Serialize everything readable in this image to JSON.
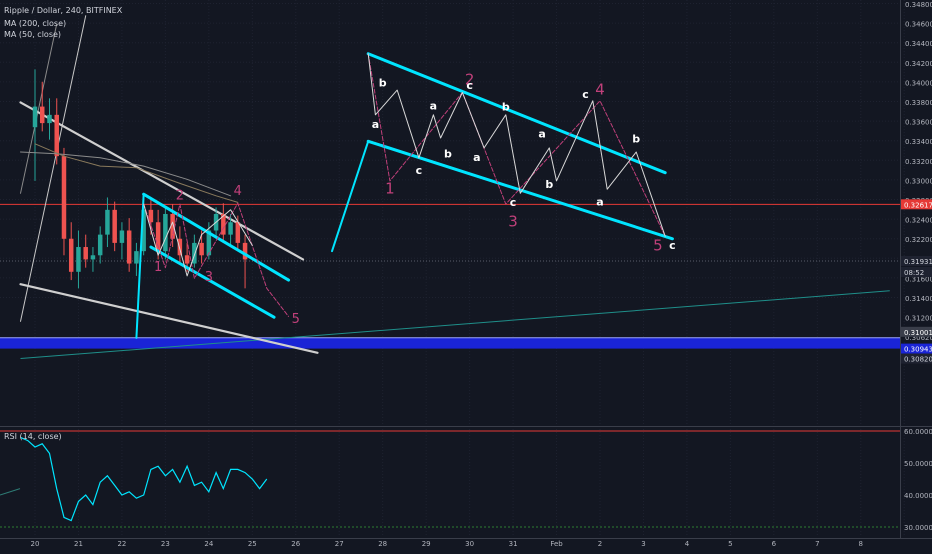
{
  "header": {
    "symbol_line": "Ripple / Dollar, 240, BITFINEX",
    "ma200_label": "MA (200, close)",
    "ma50_label": "MA (50, close)",
    "rsi_label": "RSI (14, close)"
  },
  "colors": {
    "background": "#131722",
    "up_candle": "#26a69a",
    "down_candle": "#ef5350",
    "wedge_lines": "#ffffff",
    "channel": "#00e5ff",
    "wave_primary": "#c0407a",
    "wave_subwave": "#ffffff",
    "red_level": "#e53935",
    "blue_zone": "#1a24d6",
    "rsi_line": "#00e5ff"
  },
  "chart_data": [
    {
      "type": "candlestick",
      "title": "Ripple / Dollar, 240, BITFINEX",
      "y_axis_side": "right",
      "y_tick_labels": [
        "0.34800",
        "0.34600",
        "0.34400",
        "0.34200",
        "0.34000",
        "0.33800",
        "0.33600",
        "0.33400",
        "0.33200",
        "0.33000",
        "0.32800",
        "0.32400",
        "0.32200",
        "0.32000",
        "0.31600",
        "0.31400",
        "0.31200",
        "0.30620",
        "0.30640"
      ],
      "x_tick_labels": [
        "20",
        "21",
        "22",
        "23",
        "24",
        "25",
        "26",
        "27",
        "28",
        "29",
        "30",
        "31",
        "Feb",
        "2",
        "3",
        "4",
        "5",
        "6",
        "7",
        "8"
      ],
      "price_labels": {
        "red_level": "0.32617",
        "current_price": "0.31931",
        "countdown": "08:52",
        "zone_top": "0.31001",
        "zone_mid": "0.30943",
        "zone_bottom": "0.30820"
      },
      "candles": [
        {
          "x": "Jan 20 00:00",
          "o": 0.3355,
          "h": 0.3425,
          "l": 0.329,
          "c": 0.338
        },
        {
          "x": "Jan 20 04:00",
          "o": 0.338,
          "h": 0.341,
          "l": 0.335,
          "c": 0.336
        },
        {
          "x": "Jan 20 08:00",
          "o": 0.336,
          "h": 0.339,
          "l": 0.334,
          "c": 0.337
        },
        {
          "x": "Jan 20 12:00",
          "o": 0.337,
          "h": 0.339,
          "l": 0.331,
          "c": 0.332
        },
        {
          "x": "Jan 20 16:00",
          "o": 0.332,
          "h": 0.333,
          "l": 0.32,
          "c": 0.322
        },
        {
          "x": "Jan 20 20:00",
          "o": 0.322,
          "h": 0.324,
          "l": 0.317,
          "c": 0.318
        },
        {
          "x": "Jan 21 00:00",
          "o": 0.318,
          "h": 0.323,
          "l": 0.316,
          "c": 0.321
        },
        {
          "x": "Jan 21 04:00",
          "o": 0.321,
          "h": 0.3225,
          "l": 0.3185,
          "c": 0.3195
        },
        {
          "x": "Jan 21 08:00",
          "o": 0.3195,
          "h": 0.321,
          "l": 0.318,
          "c": 0.32
        },
        {
          "x": "Jan 21 12:00",
          "o": 0.32,
          "h": 0.3235,
          "l": 0.319,
          "c": 0.3225
        },
        {
          "x": "Jan 21 16:00",
          "o": 0.3225,
          "h": 0.327,
          "l": 0.321,
          "c": 0.3255
        },
        {
          "x": "Jan 21 20:00",
          "o": 0.3255,
          "h": 0.3265,
          "l": 0.3205,
          "c": 0.3215
        },
        {
          "x": "Jan 22 00:00",
          "o": 0.3215,
          "h": 0.324,
          "l": 0.3195,
          "c": 0.323
        },
        {
          "x": "Jan 22 04:00",
          "o": 0.323,
          "h": 0.3245,
          "l": 0.318,
          "c": 0.319
        },
        {
          "x": "Jan 22 08:00",
          "o": 0.319,
          "h": 0.3215,
          "l": 0.3175,
          "c": 0.3205
        },
        {
          "x": "Jan 22 12:00",
          "o": 0.3205,
          "h": 0.3265,
          "l": 0.32,
          "c": 0.3255
        },
        {
          "x": "Jan 22 16:00",
          "o": 0.3255,
          "h": 0.327,
          "l": 0.3225,
          "c": 0.324
        },
        {
          "x": "Jan 22 20:00",
          "o": 0.324,
          "h": 0.3255,
          "l": 0.3195,
          "c": 0.3205
        },
        {
          "x": "Jan 23 00:00",
          "o": 0.3205,
          "h": 0.326,
          "l": 0.3195,
          "c": 0.325
        },
        {
          "x": "Jan 23 04:00",
          "o": 0.325,
          "h": 0.3262,
          "l": 0.321,
          "c": 0.322
        },
        {
          "x": "Jan 23 08:00",
          "o": 0.322,
          "h": 0.3235,
          "l": 0.319,
          "c": 0.32
        },
        {
          "x": "Jan 23 12:00",
          "o": 0.32,
          "h": 0.3215,
          "l": 0.318,
          "c": 0.319
        },
        {
          "x": "Jan 23 16:00",
          "o": 0.319,
          "h": 0.3225,
          "l": 0.3185,
          "c": 0.3215
        },
        {
          "x": "Jan 23 20:00",
          "o": 0.3215,
          "h": 0.323,
          "l": 0.319,
          "c": 0.32
        },
        {
          "x": "Jan 24 00:00",
          "o": 0.32,
          "h": 0.324,
          "l": 0.3195,
          "c": 0.323
        },
        {
          "x": "Jan 24 04:00",
          "o": 0.323,
          "h": 0.3258,
          "l": 0.322,
          "c": 0.325
        },
        {
          "x": "Jan 24 08:00",
          "o": 0.325,
          "h": 0.3263,
          "l": 0.3215,
          "c": 0.3225
        },
        {
          "x": "Jan 24 12:00",
          "o": 0.3225,
          "h": 0.325,
          "l": 0.321,
          "c": 0.324
        },
        {
          "x": "Jan 24 16:00",
          "o": 0.324,
          "h": 0.3248,
          "l": 0.3205,
          "c": 0.3215
        },
        {
          "x": "Jan 24 20:00",
          "o": 0.3215,
          "h": 0.3225,
          "l": 0.316,
          "c": 0.3195
        }
      ],
      "series": [
        {
          "name": "MA (200, close)",
          "color": "#8c8c8c",
          "x": [
            "Jan 19 16:00",
            "Jan 20 12:00",
            "Jan 21 12:00",
            "Jan 22 12:00",
            "Jan 23 12:00",
            "Jan 24 12:00"
          ],
          "y": [
            0.3325,
            0.3323,
            0.3318,
            0.3308,
            0.3292,
            0.3272
          ]
        },
        {
          "name": "MA (50, close)",
          "color": "#8a7a5c",
          "x": [
            "Jan 20 00:00",
            "Jan 20 16:00",
            "Jan 21 12:00",
            "Jan 22 08:00",
            "Jan 23 08:00",
            "Jan 24 04:00",
            "Jan 24 16:00"
          ],
          "y": [
            0.3335,
            0.332,
            0.3308,
            0.3306,
            0.3287,
            0.3272,
            0.3264
          ]
        }
      ],
      "annotations": {
        "wedge_upper": [
          [
            "Jan 19 16:00",
            0.3385
          ],
          [
            "Jan 26 04:00",
            0.3195
          ]
        ],
        "wedge_lower": [
          [
            "Jan 19 16:00",
            0.3165
          ],
          [
            "Jan 26 12:00",
            0.3082
          ]
        ],
        "fan_line_1": [
          [
            "Jan 19 16:00",
            0.312
          ],
          [
            "Jan 21 04:00",
            0.349
          ]
        ],
        "fan_line_2": [
          [
            "Jan 19 16:00",
            0.3275
          ],
          [
            "Jan 20 12:00",
            0.348
          ]
        ],
        "small_channel_upper": [
          [
            "Jan 22 12:00",
            0.3274
          ],
          [
            "Jan 25 20:00",
            0.317
          ]
        ],
        "small_channel_lower": [
          [
            "Jan 22 16:00",
            0.321
          ],
          [
            "Jan 25 12:00",
            0.3125
          ]
        ],
        "small_channel_start": [
          [
            "Jan 22 08:00",
            0.31
          ],
          [
            "Jan 22 12:00",
            0.3274
          ]
        ],
        "big_channel_upper": [
          [
            "Jan 27 16:00",
            0.3444
          ],
          [
            "Feb 3 12:00",
            0.33
          ]
        ],
        "big_channel_lower": [
          [
            "Jan 27 16:00",
            0.3338
          ],
          [
            "Feb 3 16:00",
            0.322
          ]
        ],
        "big_channel_start": [
          [
            "Jan 26 20:00",
            0.3205
          ],
          [
            "Jan 27 16:00",
            0.3338
          ]
        ],
        "red_level_price": 0.32617,
        "blue_zone": [
          0.30943,
          0.31001
        ],
        "trendline_teal": [
          [
            "Jan 19 16:00",
            0.3075
          ],
          [
            "Feb 8 16:00",
            0.3157
          ]
        ],
        "wave_small_pink": [
          [
            "Jan 22 12:00",
            0.3262
          ],
          [
            "Jan 23 00:00",
            0.3185
          ],
          [
            "Jan 23 08:00",
            0.3262
          ],
          [
            "Jan 23 16:00",
            0.3172
          ],
          [
            "Jan 24 16:00",
            0.3263
          ],
          [
            "Jan 25 08:00",
            0.316
          ],
          [
            "Jan 25 20:00",
            0.3126
          ]
        ],
        "wave_small_white": [
          [
            "Jan 22 12:00",
            0.3262
          ],
          [
            "Jan 22 20:00",
            0.32
          ],
          [
            "Jan 23 04:00",
            0.324
          ],
          [
            "Jan 23 12:00",
            0.3175
          ],
          [
            "Jan 23 20:00",
            0.3225
          ],
          [
            "Jan 24 12:00",
            0.3255
          ],
          [
            "Jan 25 00:00",
            0.3212
          ]
        ],
        "wave_large_pink": [
          [
            "Jan 27 16:00",
            0.3444
          ],
          [
            "Jan 28 04:00",
            0.329
          ],
          [
            "Jan 29 20:00",
            0.3397
          ],
          [
            "Jan 30 20:00",
            0.3262
          ],
          [
            "Feb 2 00:00",
            0.3387
          ],
          [
            "Feb 3 12:00",
            0.3223
          ]
        ],
        "wave_large_white": [
          [
            "Jan 27 16:00",
            0.3444
          ],
          [
            "Jan 27 20:00",
            0.337
          ],
          [
            "Jan 28 08:00",
            0.34
          ],
          [
            "Jan 28 20:00",
            0.3318
          ],
          [
            "Jan 29 04:00",
            0.337
          ],
          [
            "Jan 29 08:00",
            0.3342
          ],
          [
            "Jan 29 20:00",
            0.3397
          ],
          [
            "Jan 30 08:00",
            0.333
          ],
          [
            "Jan 30 20:00",
            0.337
          ],
          [
            "Jan 31 04:00",
            0.3275
          ],
          [
            "Jan 31 20:00",
            0.333
          ],
          [
            "Feb 1 00:00",
            0.329
          ],
          [
            "Feb 1 20:00",
            0.3387
          ],
          [
            "Feb 2 04:00",
            0.328
          ],
          [
            "Feb 2 20:00",
            0.3325
          ],
          [
            "Feb 3 12:00",
            0.3223
          ]
        ]
      },
      "wave_labels": {
        "small": [
          {
            "text": "1",
            "color": "pink",
            "x": "Jan 22 20:00",
            "y": 0.3185
          },
          {
            "text": "2",
            "color": "pink",
            "x": "Jan 23 08:00",
            "y": 0.3272
          },
          {
            "text": "3",
            "color": "pink",
            "x": "Jan 24 00:00",
            "y": 0.3173
          },
          {
            "text": "4",
            "color": "pink",
            "x": "Jan 24 16:00",
            "y": 0.3277
          },
          {
            "text": "5",
            "color": "pink",
            "x": "Jan 26 00:00",
            "y": 0.3122
          }
        ],
        "large": [
          {
            "text": "1",
            "color": "pink",
            "x": "Jan 28 04:00",
            "y": 0.328
          },
          {
            "text": "2",
            "color": "pink",
            "x": "Jan 30 00:00",
            "y": 0.3412
          },
          {
            "text": "3",
            "color": "pink",
            "x": "Jan 31 00:00",
            "y": 0.324
          },
          {
            "text": "4",
            "color": "pink",
            "x": "Feb 2 00:00",
            "y": 0.34
          },
          {
            "text": "5",
            "color": "pink",
            "x": "Feb 3 08:00",
            "y": 0.3211
          },
          {
            "text": "a",
            "color": "white",
            "x": "Jan 27 20:00",
            "y": 0.3358
          },
          {
            "text": "b",
            "color": "white",
            "x": "Jan 28 00:00",
            "y": 0.3408
          },
          {
            "text": "c",
            "color": "white",
            "x": "Jan 28 20:00",
            "y": 0.3302
          },
          {
            "text": "a",
            "color": "white",
            "x": "Jan 29 04:00",
            "y": 0.338
          },
          {
            "text": "b",
            "color": "white",
            "x": "Jan 29 12:00",
            "y": 0.3322
          },
          {
            "text": "a",
            "color": "white",
            "x": "Jan 30 04:00",
            "y": 0.3318
          },
          {
            "text": "c",
            "color": "white",
            "x": "Jan 30 00:00",
            "y": 0.3405
          },
          {
            "text": "b",
            "color": "white",
            "x": "Jan 30 20:00",
            "y": 0.3379
          },
          {
            "text": "a",
            "color": "white",
            "x": "Jan 31 16:00",
            "y": 0.3346
          },
          {
            "text": "c",
            "color": "white",
            "x": "Jan 31 00:00",
            "y": 0.3263
          },
          {
            "text": "b",
            "color": "white",
            "x": "Jan 31 20:00",
            "y": 0.3285
          },
          {
            "text": "c",
            "color": "white",
            "x": "Feb 1 16:00",
            "y": 0.3394
          },
          {
            "text": "a",
            "color": "white",
            "x": "Feb 2 00:00",
            "y": 0.3264
          },
          {
            "text": "b",
            "color": "white",
            "x": "Feb 2 20:00",
            "y": 0.334
          },
          {
            "text": "c",
            "color": "white",
            "x": "Feb 3 16:00",
            "y": 0.3211
          }
        ]
      }
    },
    {
      "type": "line",
      "title": "RSI (14, close)",
      "y_tick_labels": [
        "60.0000",
        "50.0000",
        "40.0000",
        "30.0000"
      ],
      "levels": [
        30,
        60
      ],
      "x": [
        "Jan 19 16:00",
        "Jan 19 20:00",
        "Jan 20 00:00",
        "Jan 20 04:00",
        "Jan 20 08:00",
        "Jan 20 12:00",
        "Jan 20 16:00",
        "Jan 20 20:00",
        "Jan 21 00:00",
        "Jan 21 04:00",
        "Jan 21 08:00",
        "Jan 21 12:00",
        "Jan 21 16:00",
        "Jan 21 20:00",
        "Jan 22 00:00",
        "Jan 22 04:00",
        "Jan 22 08:00",
        "Jan 22 12:00",
        "Jan 22 16:00",
        "Jan 22 20:00",
        "Jan 23 00:00",
        "Jan 23 04:00",
        "Jan 23 08:00",
        "Jan 23 12:00",
        "Jan 23 16:00",
        "Jan 23 20:00",
        "Jan 24 00:00",
        "Jan 24 04:00",
        "Jan 24 08:00",
        "Jan 24 12:00",
        "Jan 24 16:00",
        "Jan 24 20:00",
        "Jan 25 00:00",
        "Jan 25 04:00",
        "Jan 25 08:00"
      ],
      "y": [
        58,
        57,
        55,
        56,
        53,
        42,
        33,
        32,
        38,
        40,
        37,
        44,
        46,
        43,
        40,
        41,
        39,
        40,
        48,
        49,
        46,
        48,
        44,
        49,
        43,
        44,
        41,
        47,
        42,
        48,
        48,
        47,
        45,
        42,
        45
      ]
    }
  ]
}
